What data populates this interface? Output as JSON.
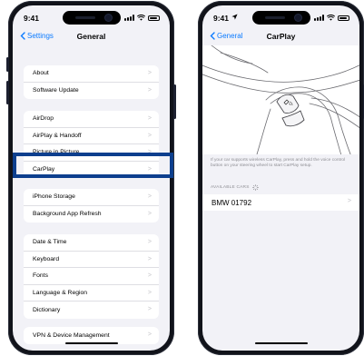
{
  "status_bar": {
    "time": "9:41"
  },
  "settings_screen": {
    "back_label": "Settings",
    "title": "General",
    "groups": [
      {
        "items": [
          "About",
          "Software Update"
        ]
      },
      {
        "items": [
          "AirDrop",
          "AirPlay & Handoff",
          "Picture in Picture",
          "CarPlay"
        ]
      },
      {
        "items": [
          "iPhone Storage",
          "Background App Refresh"
        ]
      },
      {
        "items": [
          "Date & Time",
          "Keyboard",
          "Fonts",
          "Language & Region",
          "Dictionary"
        ]
      },
      {
        "items": [
          "VPN & Device Management"
        ]
      }
    ],
    "highlighted_item": "CarPlay"
  },
  "carplay_screen": {
    "back_label": "General",
    "title": "CarPlay",
    "caption": "If your car supports wireless CarPlay, press and hold the voice control button on your steering wheel to start CarPlay setup.",
    "section_header": "AVAILABLE CARS",
    "cars": [
      "BMW 01792"
    ]
  },
  "colors": {
    "accent": "#0a7aff",
    "highlight_border": "#0d3f8e",
    "background": "#f2f2f7"
  },
  "icons": [
    "back-chevron-icon",
    "chevron-right-icon",
    "signal-icon",
    "wifi-icon",
    "battery-icon",
    "location-arrow-icon",
    "spinner-icon",
    "voice-control-icon"
  ]
}
